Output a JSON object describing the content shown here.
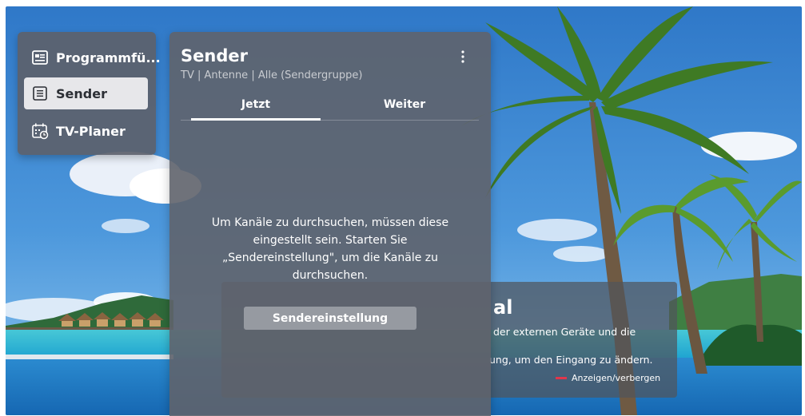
{
  "sidebar": {
    "items": [
      {
        "label": "Programmfü...",
        "icon": "program-guide-icon"
      },
      {
        "label": "Sender",
        "icon": "channel-list-icon",
        "selected": true
      },
      {
        "label": "TV-Planer",
        "icon": "calendar-clock-icon"
      }
    ]
  },
  "panel": {
    "title": "Sender",
    "subtitle": "TV | Antenne | Alle (Sendergruppe)",
    "tabs": [
      {
        "label": "Jetzt",
        "active": true
      },
      {
        "label": "Weiter",
        "active": false
      }
    ],
    "message": "Um Kanäle zu durchsuchen, müssen diese eingestellt sein. Starten Sie „Sendereinstellung\", um die Kanäle zu durchsuchen.",
    "button_label": "Sendereinstellung"
  },
  "no_signal": {
    "title_partial": "al",
    "line1_partial": "der externen Geräte und die",
    "line2_partial": "ung, um den Eingang zu ändern.",
    "hint_label": "Anzeigen/verbergen",
    "hint_color": "#e0364b"
  }
}
